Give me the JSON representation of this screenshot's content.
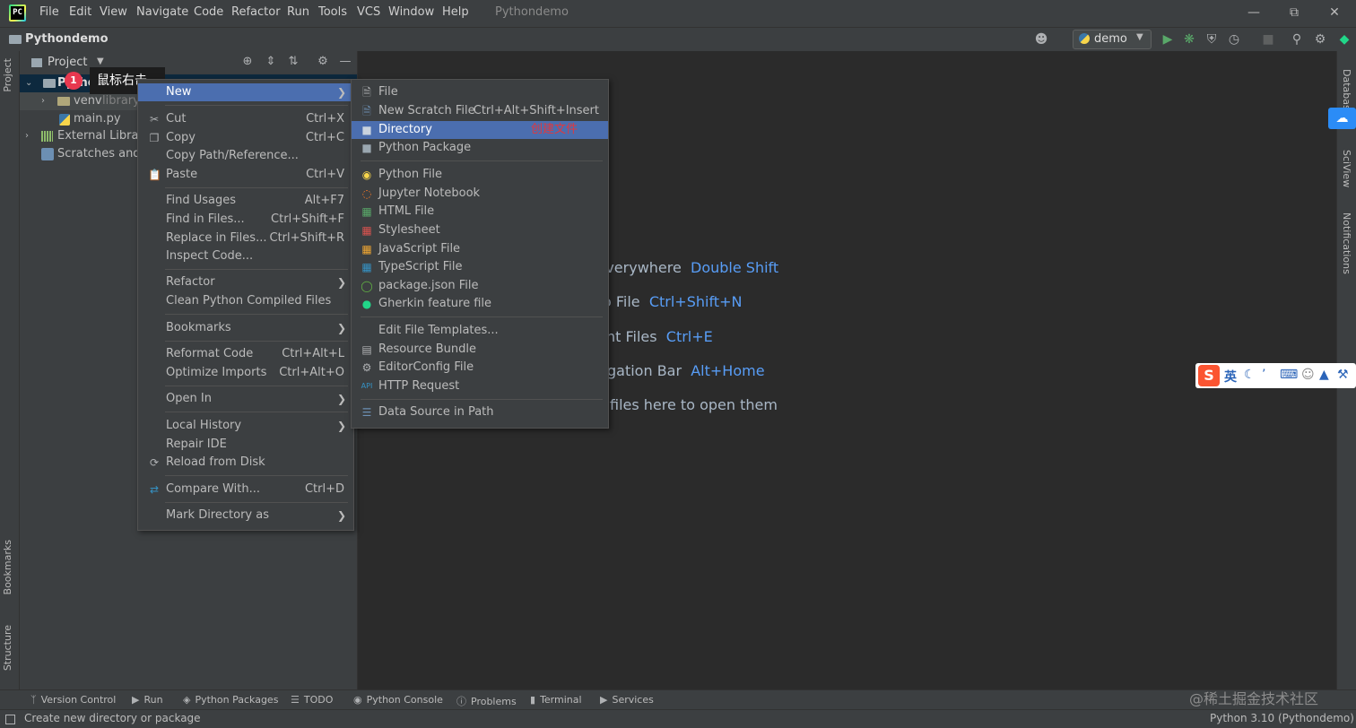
{
  "menubar": {
    "items": [
      "File",
      "Edit",
      "View",
      "Navigate",
      "Code",
      "Refactor",
      "Run",
      "Tools",
      "VCS",
      "Window",
      "Help"
    ],
    "window_title": "Pythondemo"
  },
  "navbar": {
    "project": "Pythondemo",
    "run_config": "demo"
  },
  "left_stripe": {
    "project": "Project",
    "bookmarks": "Bookmarks",
    "structure": "Structure"
  },
  "right_stripe": {
    "database": "Database",
    "sciview": "SciView",
    "notifications": "Notifications"
  },
  "project_panel": {
    "title": "Project",
    "tree": {
      "root": "Pythondemo",
      "venv": "venv",
      "venv_hint": "library root",
      "main": "main.py",
      "external": "External Libraries",
      "scratches": "Scratches and Consoles"
    }
  },
  "callout": {
    "badge": "1",
    "text": "鼠标右击"
  },
  "context_menu": {
    "items": [
      {
        "label": "New",
        "shortcut": "",
        "submenu": true,
        "icon": ""
      },
      {
        "label": "Cut",
        "shortcut": "Ctrl+X",
        "icon": "scissors-icon"
      },
      {
        "label": "Copy",
        "shortcut": "Ctrl+C",
        "icon": "copy-icon"
      },
      {
        "label": "Copy Path/Reference...",
        "shortcut": ""
      },
      {
        "label": "Paste",
        "shortcut": "Ctrl+V",
        "icon": "paste-icon"
      },
      {
        "label": "Find Usages",
        "shortcut": "Alt+F7"
      },
      {
        "label": "Find in Files...",
        "shortcut": "Ctrl+Shift+F"
      },
      {
        "label": "Replace in Files...",
        "shortcut": "Ctrl+Shift+R"
      },
      {
        "label": "Inspect Code...",
        "shortcut": ""
      },
      {
        "label": "Refactor",
        "shortcut": "",
        "submenu": true
      },
      {
        "label": "Clean Python Compiled Files",
        "shortcut": ""
      },
      {
        "label": "Bookmarks",
        "shortcut": "",
        "submenu": true
      },
      {
        "label": "Reformat Code",
        "shortcut": "Ctrl+Alt+L"
      },
      {
        "label": "Optimize Imports",
        "shortcut": "Ctrl+Alt+O"
      },
      {
        "label": "Open In",
        "shortcut": "",
        "submenu": true
      },
      {
        "label": "Local History",
        "shortcut": "",
        "submenu": true
      },
      {
        "label": "Repair IDE",
        "shortcut": ""
      },
      {
        "label": "Reload from Disk",
        "shortcut": "",
        "icon": "reload-icon"
      },
      {
        "label": "Compare With...",
        "shortcut": "Ctrl+D",
        "icon": "compare-icon"
      },
      {
        "label": "Mark Directory as",
        "shortcut": "",
        "submenu": true
      }
    ]
  },
  "new_submenu": {
    "items": [
      {
        "label": "File",
        "shortcut": "",
        "icon": "file-icon"
      },
      {
        "label": "New Scratch File",
        "shortcut": "Ctrl+Alt+Shift+Insert",
        "icon": "scratch-file-icon"
      },
      {
        "label": "Directory",
        "shortcut": "",
        "icon": "folder-icon"
      },
      {
        "label": "Python Package",
        "shortcut": "",
        "icon": "package-icon"
      },
      {
        "label": "Python File",
        "shortcut": "",
        "icon": "python-file-icon"
      },
      {
        "label": "Jupyter Notebook",
        "shortcut": "",
        "icon": "jupyter-icon"
      },
      {
        "label": "HTML File",
        "shortcut": "",
        "icon": "html-icon"
      },
      {
        "label": "Stylesheet",
        "shortcut": "",
        "icon": "css-icon"
      },
      {
        "label": "JavaScript File",
        "shortcut": "",
        "icon": "js-icon"
      },
      {
        "label": "TypeScript File",
        "shortcut": "",
        "icon": "ts-icon"
      },
      {
        "label": "package.json File",
        "shortcut": "",
        "icon": "npm-icon"
      },
      {
        "label": "Gherkin feature file",
        "shortcut": "",
        "icon": "gherkin-icon"
      },
      {
        "label": "Edit File Templates...",
        "shortcut": ""
      },
      {
        "label": "Resource Bundle",
        "shortcut": "",
        "icon": "resource-bundle-icon"
      },
      {
        "label": "EditorConfig File",
        "shortcut": "",
        "icon": "gear-icon"
      },
      {
        "label": "HTTP Request",
        "shortcut": "",
        "icon": "api-icon"
      },
      {
        "label": "Data Source in Path",
        "shortcut": "",
        "icon": "database-icon"
      }
    ],
    "annotation": "创建文件"
  },
  "welcome": {
    "lines": [
      {
        "text": "h Everywhere",
        "key": "Double Shift"
      },
      {
        "text": "o File",
        "key": "Ctrl+Shift+N"
      },
      {
        "text": "nt Files",
        "key": "Ctrl+E"
      },
      {
        "text": "gation Bar",
        "key": "Alt+Home"
      },
      {
        "text": "files here to open them",
        "key": ""
      }
    ]
  },
  "ime": {
    "logo": "S",
    "lang": "英"
  },
  "bottom_tabs": [
    "Version Control",
    "Run",
    "Python Packages",
    "TODO",
    "Python Console",
    "Problems",
    "Terminal",
    "Services"
  ],
  "statusbar": {
    "message": "Create new directory or package",
    "interpreter": "Python 3.10 (Pythondemo)"
  },
  "watermark": "@稀土掘金技术社区"
}
